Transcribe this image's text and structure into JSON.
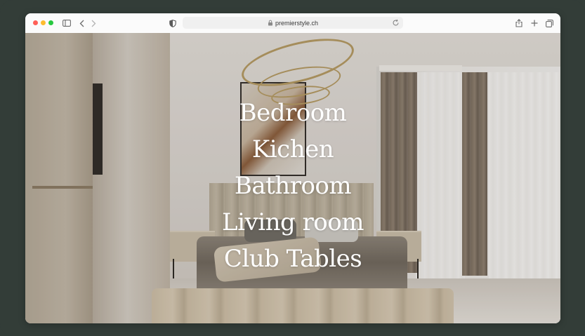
{
  "browser": {
    "url": "premierstyle.ch"
  },
  "menu": {
    "items": [
      {
        "label": "Bedroom"
      },
      {
        "label": "Kichen"
      },
      {
        "label": "Bathroom"
      },
      {
        "label": "Living room"
      },
      {
        "label": "Club Tables"
      }
    ]
  },
  "icons": {
    "sidebar": "sidebar-toggle-icon",
    "back": "chevron-left-icon",
    "forward": "chevron-right-icon",
    "privacy": "shield-icon",
    "lock": "lock-icon",
    "reload": "reload-icon",
    "share": "share-icon",
    "new_tab": "plus-icon",
    "tabs": "tab-overview-icon"
  },
  "colors": {
    "frame_background": "#333d38",
    "menu_text": "#ffffff"
  }
}
